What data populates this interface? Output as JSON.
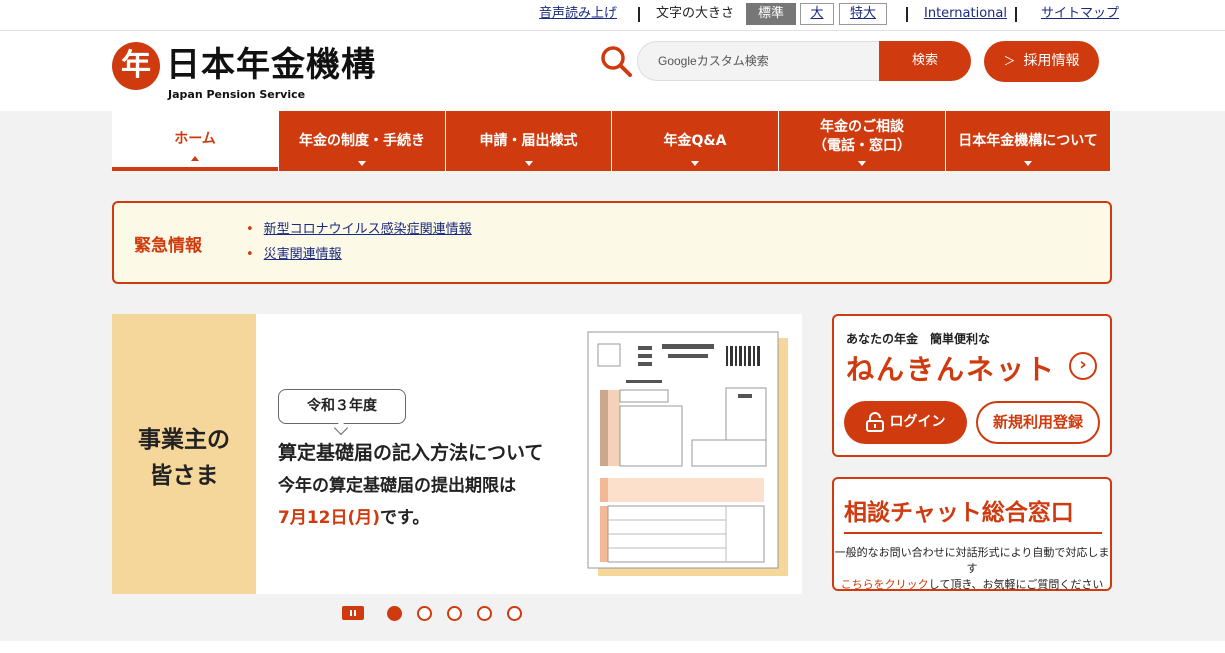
{
  "topbar": {
    "read_aloud": "音声読み上げ",
    "font_size_label": "文字の大きさ",
    "size_standard": "標準",
    "size_large": "大",
    "size_extra_large": "特大",
    "international": "International",
    "sitemap": "サイトマップ"
  },
  "header": {
    "logo_mark": "年",
    "logo_text": "日本年金機構",
    "logo_sub": "Japan Pension Service",
    "search_placeholder": "Googleカスタム検索",
    "search_button": "検索",
    "recruit_button": "採用情報"
  },
  "nav": {
    "items": [
      {
        "label": "ホーム"
      },
      {
        "label": "年金の制度・手続き"
      },
      {
        "label": "申請・届出様式"
      },
      {
        "label": "年金Q&A"
      },
      {
        "label_line1": "年金のご相談",
        "label_line2": "（電話・窓口）"
      },
      {
        "label": "日本年金機構について"
      }
    ]
  },
  "emergency": {
    "title": "緊急情報",
    "links": [
      "新型コロナウイルス感染症関連情報",
      "災害関連情報"
    ]
  },
  "slider": {
    "left_line1": "事業主の",
    "left_line2": "皆さま",
    "badge": "令和３年度",
    "line1": "算定基礎届の記入方法について",
    "line2": "今年の算定基礎届の提出期限は",
    "date": "7月12日(月)",
    "line3_suffix": "です。",
    "active_slide": 1,
    "total_slides": 5
  },
  "nenkin_net": {
    "subtitle": "あなたの年金　簡単便利な",
    "title": "ねんきんネット",
    "login": "ログイン",
    "register": "新規利用登録"
  },
  "chat": {
    "title": "相談チャット総合窓口",
    "desc_line1": "一般的なお問い合わせに対話形式により自動で対応します",
    "desc_link": "こちらをクリック",
    "desc_line2_suffix": "して頂き、お気軽にご質問ください"
  },
  "colors": {
    "brand": "#cf3a0e",
    "emergency_bg": "#fcf9e6",
    "slide_left_bg": "#f5d69b"
  }
}
